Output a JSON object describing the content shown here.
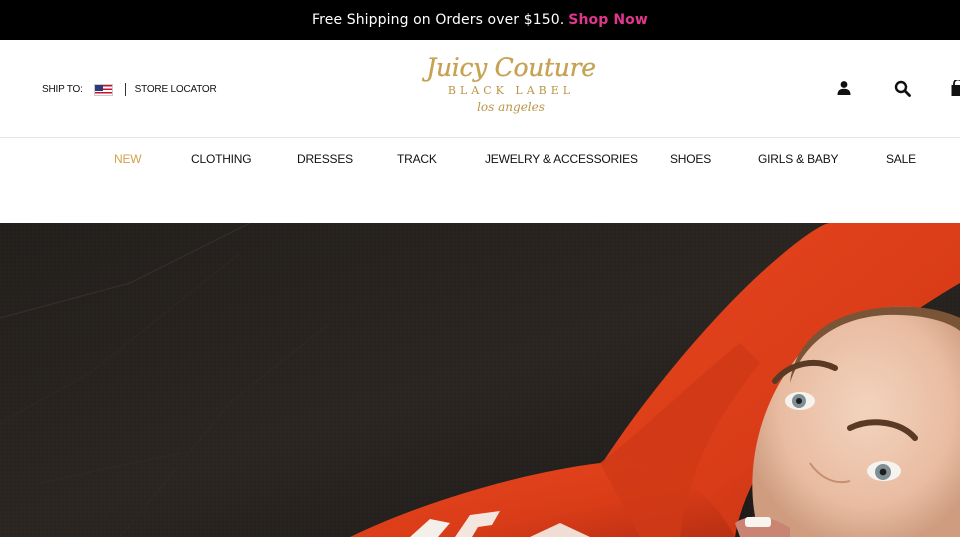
{
  "promo": {
    "text": "Free Shipping on Orders over $150.",
    "link": "Shop Now",
    "link_color": "#e0368d"
  },
  "header": {
    "ship_to_label": "SHIP TO:",
    "country_flag": "us-flag-icon",
    "store_locator": "STORE LOCATOR",
    "logo": {
      "brand": "Juicy Couture",
      "sub": "BLACK LABEL",
      "script": "los angeles",
      "color": "#c9a24e"
    },
    "icons": [
      "user-icon",
      "search-icon",
      "shopping-bag-icon"
    ]
  },
  "nav": {
    "active_color": "#d4a04c",
    "items": [
      {
        "label": "NEW"
      },
      {
        "label": "CLOTHING"
      },
      {
        "label": "DRESSES"
      },
      {
        "label": "TRACK"
      },
      {
        "label": "JEWELRY & ACCESSORIES"
      },
      {
        "label": "SHOES"
      },
      {
        "label": "GIRLS & BABY"
      },
      {
        "label": "SALE"
      }
    ]
  },
  "hero": {
    "background_color": "#1d1a17",
    "garment_color": "#e2421f"
  }
}
